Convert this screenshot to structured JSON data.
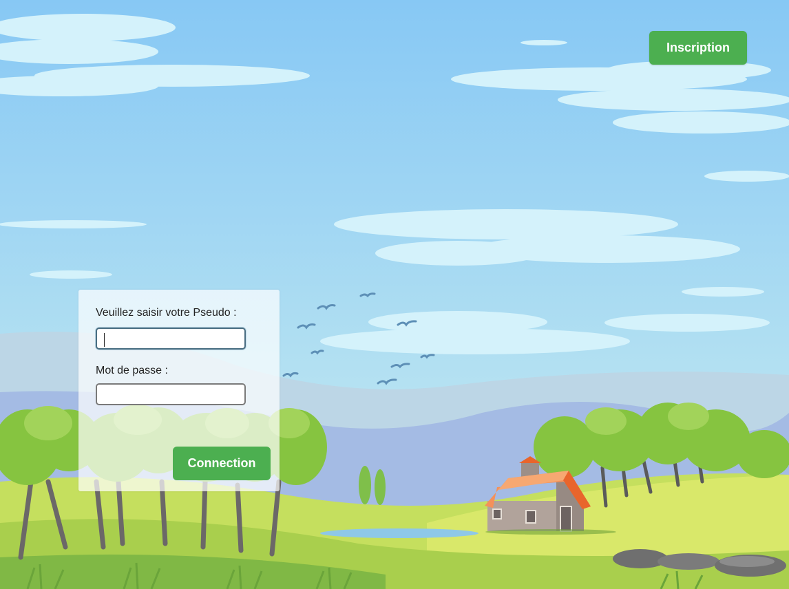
{
  "header": {
    "signup_label": "Inscription"
  },
  "login_form": {
    "username_label": "Veuillez saisir votre Pseudo :",
    "username_value": "",
    "password_label": "Mot de passe :",
    "password_value": "",
    "submit_label": "Connection"
  },
  "colors": {
    "accent_green": "#4caf50",
    "sky_top": "#88c9f3",
    "sky_bottom": "#bfe8f3",
    "grass": "#9ccc4a",
    "roof": "#f28d4b"
  }
}
